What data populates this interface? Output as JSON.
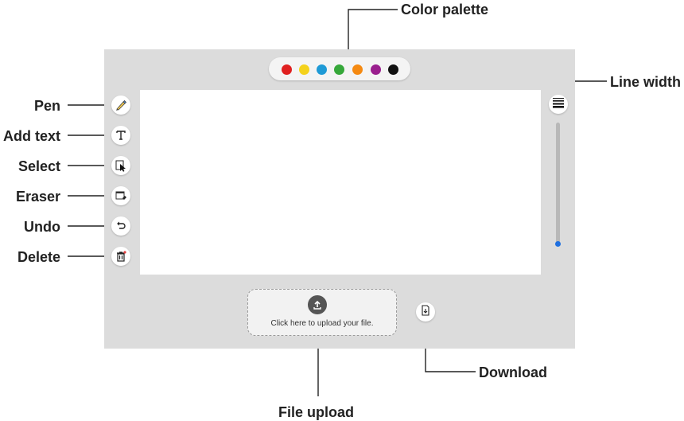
{
  "callouts": {
    "color_palette": "Color palette",
    "line_width": "Line width",
    "pen": "Pen",
    "add_text": "Add text",
    "select": "Select",
    "eraser": "Eraser",
    "undo": "Undo",
    "delete": "Delete",
    "download": "Download",
    "file_upload": "File upload"
  },
  "palette": {
    "colors": [
      "#e02020",
      "#f4d21c",
      "#1e9ad6",
      "#36a83a",
      "#f58a12",
      "#9a1f8e",
      "#111111"
    ]
  },
  "upload": {
    "text": "Click here to upload your file."
  },
  "icons": {
    "pen": "pen-icon",
    "add_text": "text-icon",
    "select": "select-icon",
    "eraser": "eraser-icon",
    "undo": "undo-icon",
    "delete": "trash-icon",
    "line_width": "line-width-icon",
    "upload": "upload-icon",
    "download": "download-icon"
  }
}
